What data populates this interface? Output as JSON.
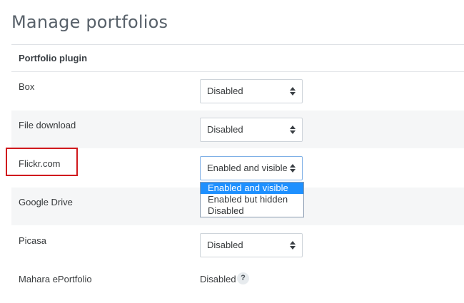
{
  "page": {
    "title": "Manage portfolios"
  },
  "table": {
    "header": "Portfolio plugin",
    "rows": [
      {
        "name": "Box",
        "value": "Disabled",
        "control": "select"
      },
      {
        "name": "File download",
        "value": "Disabled",
        "control": "select"
      },
      {
        "name": "Flickr.com",
        "value": "Enabled and visible",
        "control": "select",
        "open": true
      },
      {
        "name": "Google Drive",
        "value": "",
        "control": "select-hidden"
      },
      {
        "name": "Picasa",
        "value": "Disabled",
        "control": "select"
      },
      {
        "name": "Mahara ePortfolio",
        "value": "Disabled",
        "control": "static"
      }
    ]
  },
  "help": {
    "icon": "question-icon",
    "glyph": "?"
  },
  "dropdown": {
    "options": [
      "Enabled and visible",
      "Enabled but hidden",
      "Disabled"
    ],
    "selected": "Enabled and visible"
  },
  "colors": {
    "highlight": "#d0191d",
    "selected_option": "#1e90ff",
    "stripe": "#f5f6f7"
  }
}
